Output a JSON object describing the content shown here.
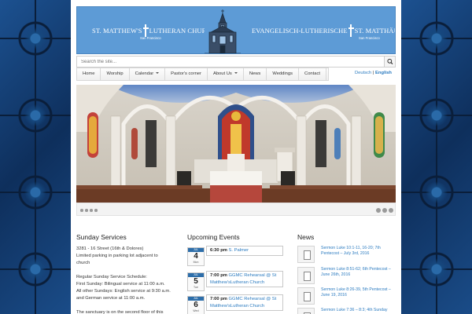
{
  "banner": {
    "left_title_a": "ST. MATTHEW'S",
    "left_title_b": "LUTHERAN CHURCH",
    "left_subtitle": "San Francisco",
    "right_title_a": "EVANGELISCH-LUTHERISCHE",
    "right_title_b": "ST. MATTHÄUS-KIRCHE",
    "right_subtitle": "San Francisco"
  },
  "search": {
    "placeholder": "Search the site...",
    "icon": "search-icon"
  },
  "nav": {
    "items": [
      {
        "label": "Home",
        "dropdown": false
      },
      {
        "label": "Worship",
        "dropdown": false
      },
      {
        "label": "Calendar",
        "dropdown": true
      },
      {
        "label": "Pastor's corner",
        "dropdown": false
      },
      {
        "label": "About Us",
        "dropdown": true
      },
      {
        "label": "News",
        "dropdown": false
      },
      {
        "label": "Weddings",
        "dropdown": false
      },
      {
        "label": "Contact",
        "dropdown": false
      }
    ]
  },
  "language": {
    "deutsch": "Deutsch",
    "separator": "|",
    "english": "English"
  },
  "sunday": {
    "heading": "Sunday Services",
    "lines": [
      "3281 - 16 Street (16th & Dolores)",
      "Limited parking in parking lot adjacent to",
      "church",
      "",
      "Regular Sunday Service Schedule:",
      "First Sunday: Bilingual service at 11:00 a.m.",
      "All other Sundays: English service at 9:30 a.m.",
      "and German service at 11:00 a.m.",
      "",
      "The sanctuary is on the second floor of this"
    ]
  },
  "events": {
    "heading": "Upcoming Events",
    "items": [
      {
        "month": "JUL",
        "day": "4",
        "weekday": "Mon",
        "time": "6:30 pm",
        "title": "S. Palmer"
      },
      {
        "month": "JUL",
        "day": "5",
        "weekday": "Tue",
        "time": "7:00 pm",
        "title": "GGMC Rehearsal @ St Matthew'sLutheran Church"
      },
      {
        "month": "JUL",
        "day": "6",
        "weekday": "Wed",
        "time": "7:00 pm",
        "title": "GGMC Rehearsal @ St Matthew'sLutheran Church"
      }
    ]
  },
  "news": {
    "heading": "News",
    "items": [
      {
        "title": "Sermon Luke 10:1-11, 16-20; 7th Pentecost – July 3rd, 2016"
      },
      {
        "title": "Sermon Luke 8:51-62; 6th Pentecost – June 26th, 2016"
      },
      {
        "title": "Sermon Luke 8:26-39, 5th Pentecost – June 19, 2016"
      },
      {
        "title": "Sermon Luke 7:36 – 8:3; 4th Sunday"
      }
    ]
  }
}
